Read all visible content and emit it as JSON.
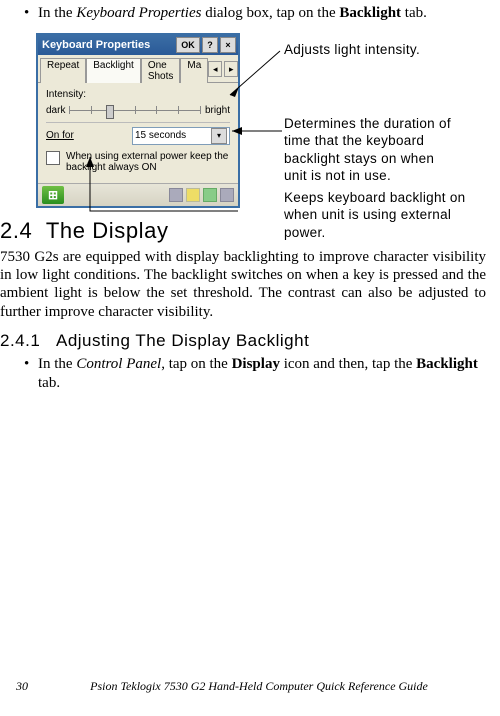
{
  "intro": {
    "bullet": "•",
    "text_before": "In the ",
    "italics": "Keyboard Properties",
    "text_mid": " dialog box, tap on the ",
    "bold": "Backlight",
    "text_after": " tab."
  },
  "dialog": {
    "title": "Keyboard Properties",
    "ok": "OK",
    "close": "×",
    "help": "?",
    "tabs": [
      "Repeat",
      "Backlight",
      "One Shots",
      "Ma"
    ],
    "intensity_label": "Intensity:",
    "dark": "dark",
    "bright": "bright",
    "on_for": "On for",
    "duration": "15 seconds",
    "checkbox_text": "When using external power keep the backlight always ON"
  },
  "annotations": {
    "a1": "Adjusts light intensity.",
    "a2": "Determines the duration of time that the keyboard backlight stays on when unit is not in use.",
    "a3": "Keeps keyboard backlight on when unit is using external power."
  },
  "sections": {
    "h2_num": "2.4",
    "h2_title": "The Display",
    "p1": "7530 G2s are equipped with display backlighting to improve character visibility in low light conditions. The backlight switches on when a key is pressed and the ambient light is below the set threshold. The contrast can also be adjusted to further improve character visibility.",
    "h3_num": "2.4.1",
    "h3_title": "Adjusting The Display Backlight",
    "p2_bullet": "•",
    "p2_before": "In the ",
    "p2_italics": "Control Panel",
    "p2_mid": ", tap on the ",
    "p2_bold1": "Display",
    "p2_mid2": " icon and then, tap the ",
    "p2_bold2": "Backlight",
    "p2_after": " tab."
  },
  "footer": {
    "page": "30",
    "source": "Psion Teklogix 7530 G2 Hand-Held Computer Quick Reference Guide"
  }
}
